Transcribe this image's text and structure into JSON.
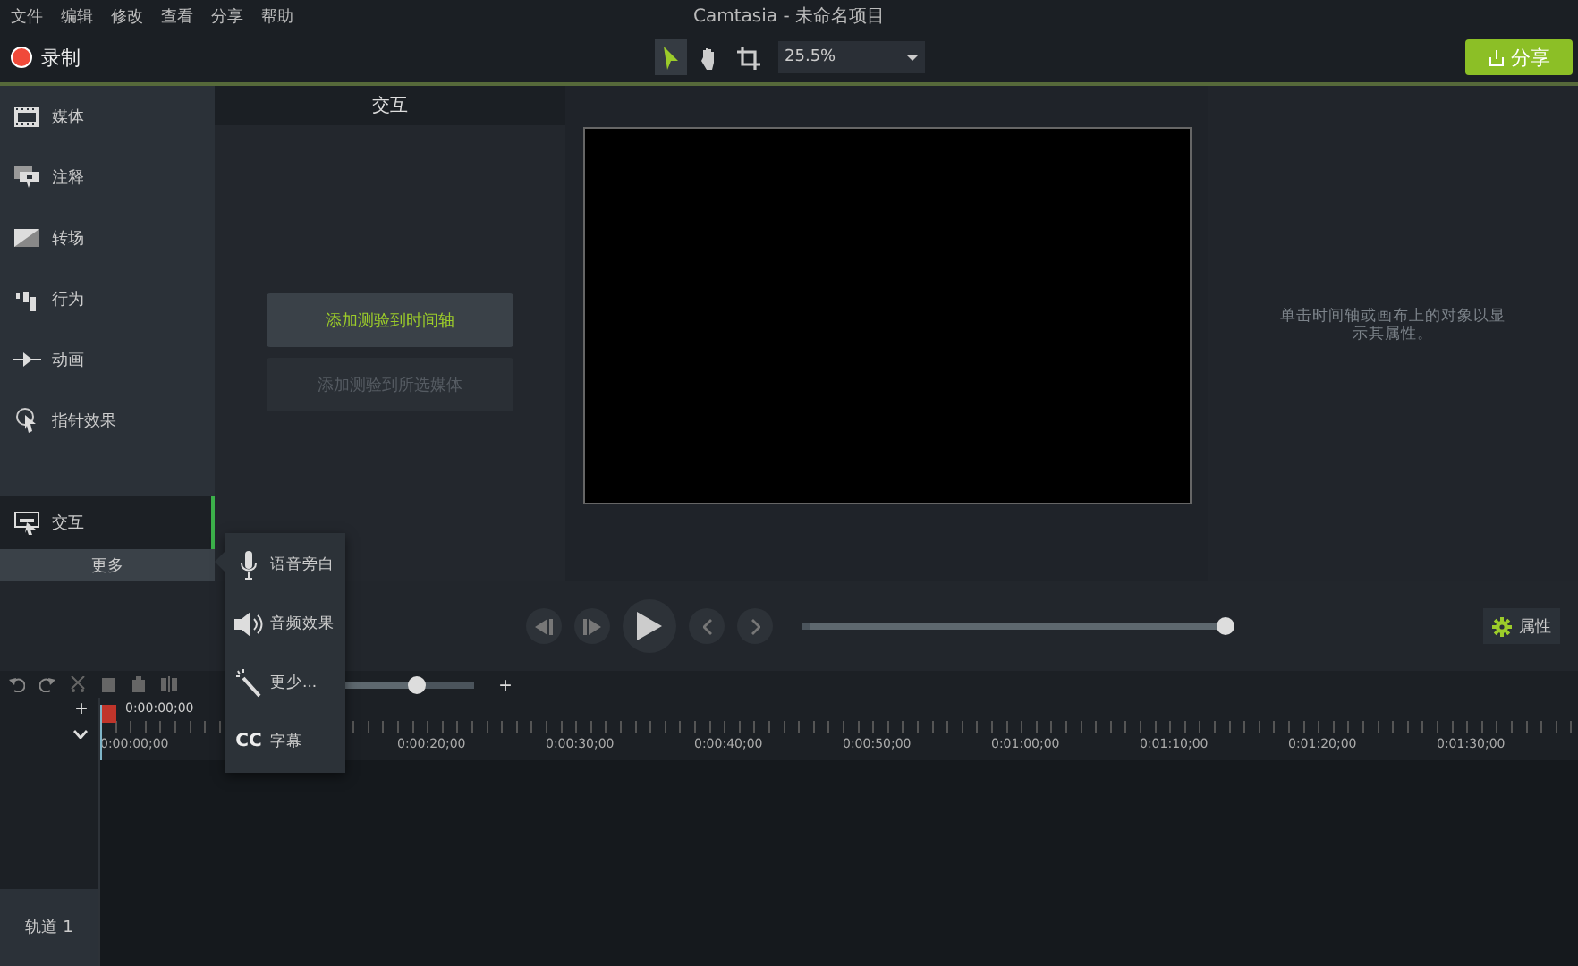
{
  "menu": [
    "文件",
    "编辑",
    "修改",
    "查看",
    "分享",
    "帮助"
  ],
  "window": {
    "title": "Camtasia - 未命名项目"
  },
  "toolbar": {
    "record": "录制",
    "tools": [
      {
        "kind": "pointer",
        "selected": true
      },
      {
        "kind": "hand",
        "selected": false
      },
      {
        "kind": "crop",
        "selected": false
      }
    ],
    "zoom": "25.5%",
    "share": "分享"
  },
  "sidebar": {
    "items": [
      {
        "kind": "media",
        "label": "媒体",
        "selected": false
      },
      {
        "kind": "annotations",
        "label": "注释",
        "selected": false
      },
      {
        "kind": "transitions",
        "label": "转场",
        "selected": false
      },
      {
        "kind": "behaviors",
        "label": "行为",
        "selected": false
      },
      {
        "kind": "animations",
        "label": "动画",
        "selected": false
      },
      {
        "kind": "cursor",
        "label": "指针效果",
        "selected": false
      },
      {
        "kind": "interactivity",
        "label": "交互",
        "selected": true
      }
    ],
    "more": "更多"
  },
  "panel": {
    "title": "交互",
    "buttons": [
      {
        "label": "添加测验到时间轴",
        "disabled": false
      },
      {
        "label": "添加测验到所选媒体",
        "disabled": true
      }
    ]
  },
  "properties": {
    "hint": "单击时间轴或画布上的对象以显示其属性。",
    "button": "属性"
  },
  "playback": {
    "level": 1
  },
  "timeline": {
    "zoom_slider": {
      "level": 0.6
    },
    "zoom_in": "+",
    "add_track": "+",
    "playhead": "0:00:00;00",
    "ruler": [
      "0:00:00;00",
      "0:00:20;00",
      "0:00:30;00",
      "0:00:40;00",
      "0:00:50;00",
      "0:01:00;00",
      "0:01:10;00",
      "0:01:20;00",
      "0:01:30;00"
    ],
    "tracks": [
      {
        "label": "轨道 1"
      }
    ]
  },
  "popup": {
    "items": [
      {
        "kind": "mic",
        "label": "语音旁白"
      },
      {
        "kind": "speaker",
        "label": "音频效果"
      },
      {
        "kind": "wand",
        "label": "更少..."
      },
      {
        "kind": "cc",
        "icon": "CC",
        "label": "字幕"
      }
    ]
  }
}
